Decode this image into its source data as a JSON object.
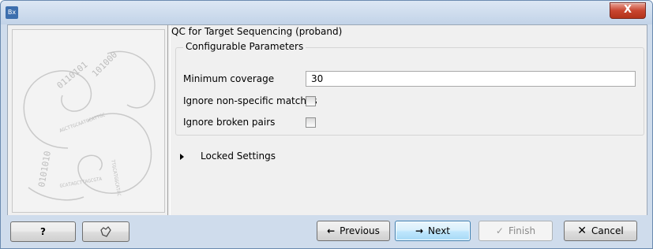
{
  "window": {
    "app_icon": "Bx",
    "close_symbol": "X"
  },
  "panel": {
    "title": "QC for Target Sequencing (proband)"
  },
  "parameters": {
    "group_title": "Configurable Parameters",
    "min_coverage_label": "Minimum coverage",
    "min_coverage_value": "30",
    "ignore_nonspecific_label": "Ignore non-specific matches",
    "ignore_nonspecific_checked": false,
    "ignore_broken_pairs_label": "Ignore broken pairs",
    "ignore_broken_pairs_checked": false
  },
  "locked": {
    "label": "Locked Settings"
  },
  "buttons": {
    "help": "?",
    "reset_icon": "reset-icon",
    "previous": "Previous",
    "next": "Next",
    "finish": "Finish",
    "cancel": "Cancel"
  }
}
